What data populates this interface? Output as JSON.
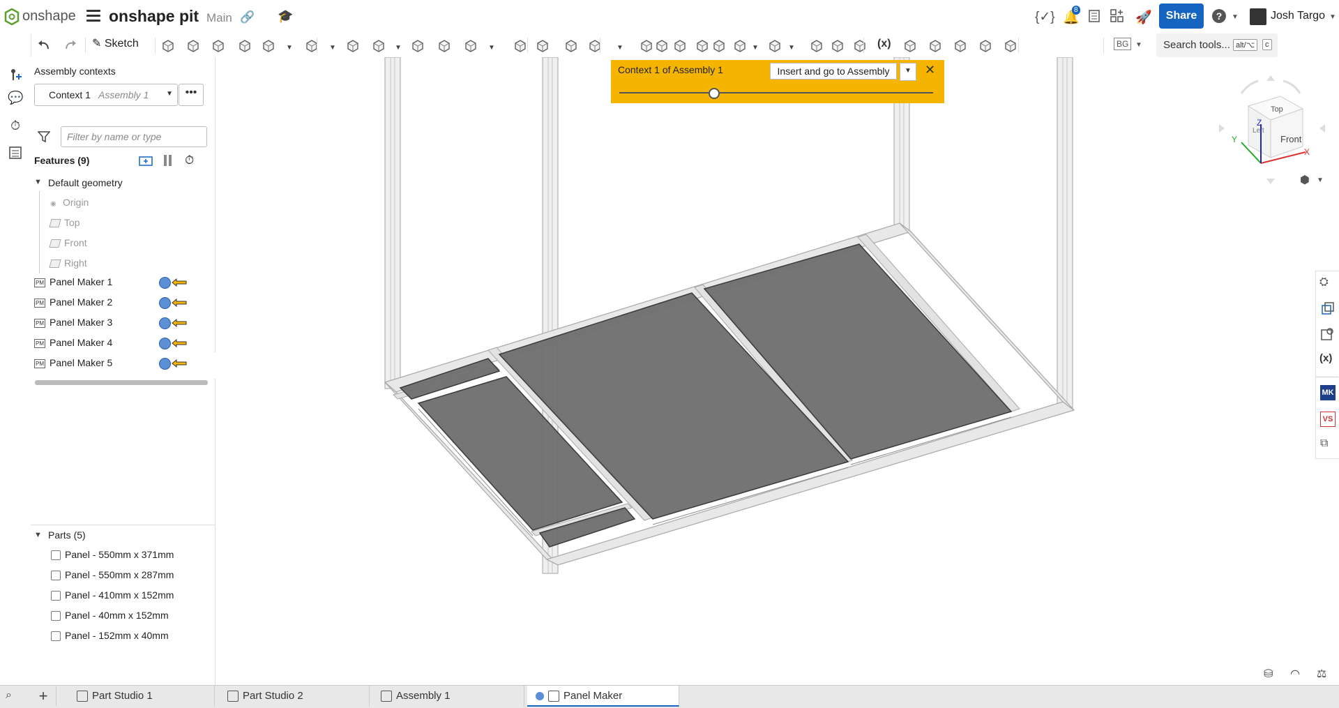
{
  "app": {
    "logo_text": "onshape",
    "doc_name": "onshape pit",
    "branch": "Main",
    "notification_count": "8",
    "share_label": "Share",
    "user_name": "Josh Targo"
  },
  "toolbar": {
    "sketch_label": "Sketch",
    "search_label": "Search tools...",
    "search_kbd1": "alt/⌥",
    "search_kbd2": "c",
    "variable_label": "(x)",
    "bg_label": "BG"
  },
  "panel": {
    "title": "Assembly contexts",
    "context_name": "Context 1",
    "context_assembly": "Assembly 1",
    "more": "•••",
    "filter_placeholder": "Filter by name or type",
    "features_title": "Features (9)",
    "default_geometry": "Default geometry",
    "geometry": [
      "Origin",
      "Top",
      "Front",
      "Right"
    ],
    "pm_badge": "PM",
    "features": [
      "Panel Maker 1",
      "Panel Maker 2",
      "Panel Maker 3",
      "Panel Maker 4",
      "Panel Maker 5"
    ],
    "parts_title": "Parts (5)",
    "parts": [
      "Panel - 550mm x 371mm",
      "Panel - 550mm x 287mm",
      "Panel - 410mm x 152mm",
      "Panel - 40mm x 152mm",
      "Panel - 152mm x 40mm"
    ]
  },
  "banner": {
    "label": "Context 1 of Assembly 1",
    "button": "Insert and go to Assembly",
    "slider_fraction": 0.3
  },
  "viewcube": {
    "top": "Top",
    "front": "Front",
    "left": "Left",
    "axis_x": "X",
    "axis_y": "Y",
    "axis_z": "Z"
  },
  "right_bar": {
    "mk": "MK",
    "vs": "VS"
  },
  "tabs": [
    "Part Studio 1",
    "Part Studio 2",
    "Assembly 1",
    "Panel Maker"
  ],
  "colors": {
    "accent": "#1565c0",
    "banner": "#f5b400",
    "panel_fill": "#6e6e6e",
    "frame": "#d8d8d8"
  }
}
